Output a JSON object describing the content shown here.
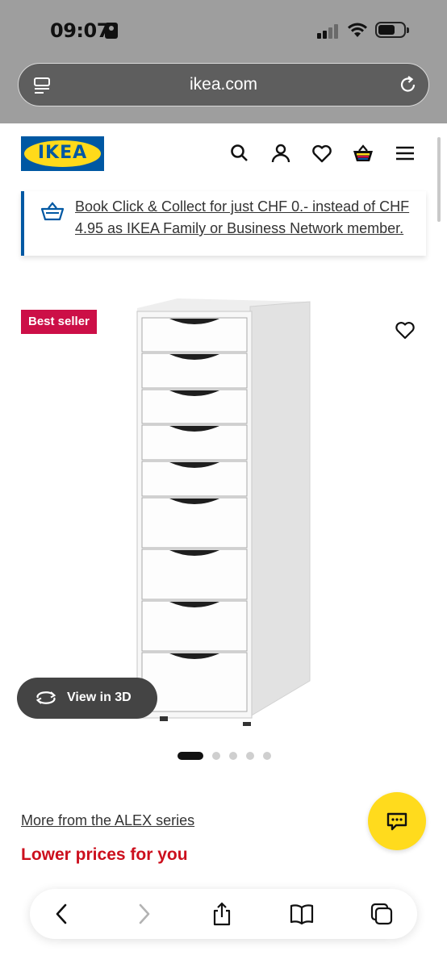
{
  "status_bar": {
    "time": "09:07"
  },
  "browser": {
    "url": "ikea.com"
  },
  "header": {
    "logo_text": "IKEA"
  },
  "promo": {
    "text": "Book Click & Collect for just CHF 0.- instead of CHF 4.95 as IKEA Family or Business Network member."
  },
  "product": {
    "badge": "Best seller",
    "view_3d_label": "View in 3D",
    "image_count": 5,
    "active_image_index": 0
  },
  "links": {
    "series": "More from the ALEX series",
    "lower_prices": "Lower prices for you"
  },
  "colors": {
    "ikea_blue": "#0058a3",
    "ikea_yellow": "#ffda1a",
    "badge_red": "#cc0f47",
    "lower_prices_red": "#cc0f1d",
    "chat_yellow": "#ffdb1d"
  },
  "icons": {
    "header": [
      "search-icon",
      "user-icon",
      "heart-icon",
      "basket-icon",
      "menu-icon"
    ],
    "toolbar": [
      "back-icon",
      "forward-icon",
      "share-icon",
      "bookmarks-icon",
      "tabs-icon"
    ]
  }
}
